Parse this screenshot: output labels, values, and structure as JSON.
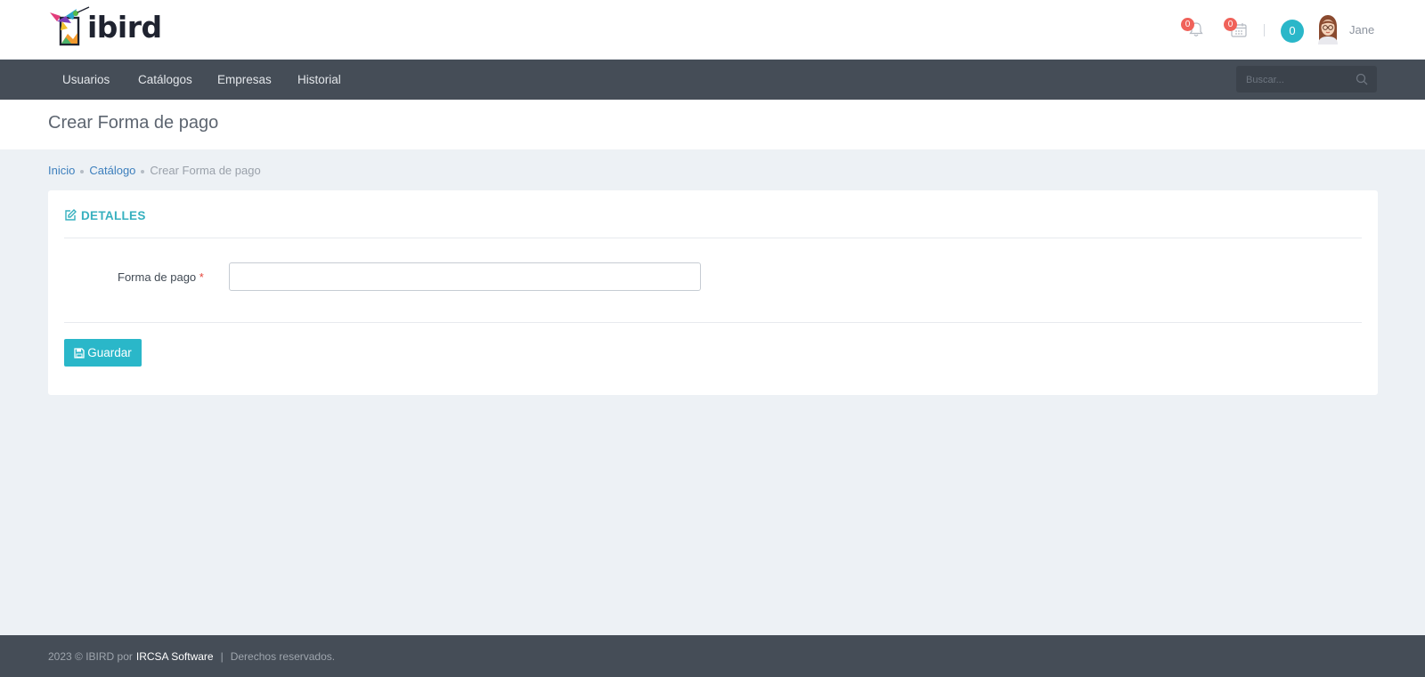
{
  "brand": {
    "logo_text": "ibird"
  },
  "header": {
    "notifications_count": "0",
    "calendar_count": "0",
    "messages_count": "0",
    "user_name": "Jane"
  },
  "nav": {
    "items": [
      "Usuarios",
      "Catálogos",
      "Empresas",
      "Historial"
    ],
    "search_placeholder": "Buscar..."
  },
  "page": {
    "title": "Crear Forma de pago"
  },
  "breadcrumb": [
    "Inicio",
    "Catálogo",
    "Crear Forma de pago"
  ],
  "card": {
    "title": "DETALLES",
    "field_label": "Forma de pago",
    "required_mark": "*",
    "field_value": "",
    "save_label": "Guardar"
  },
  "footer": {
    "copyright": "2023 © IBIRD por",
    "company": "IRCSA Software",
    "separator": "|",
    "rights": "Derechos reservados."
  },
  "colors": {
    "accent": "#2ab7c9",
    "navbar": "#454d57",
    "badge": "#f0625a",
    "link": "#3d7fbd",
    "background": "#edf1f5"
  },
  "icons": [
    "bell-icon",
    "calendar-icon",
    "avatar",
    "search-icon",
    "edit-icon",
    "save-icon"
  ]
}
